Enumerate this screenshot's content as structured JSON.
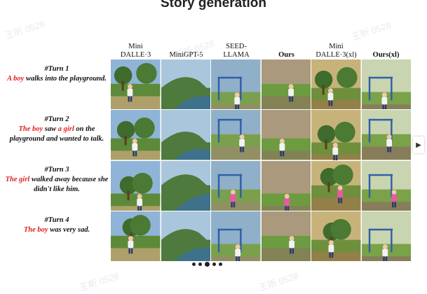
{
  "title": "Story generation",
  "watermark": "王昕 0528",
  "columns": [
    "Mini DALLE·3",
    "MiniGPT-5",
    "SEED-LLAMA",
    "Ours",
    "Mini DALLE·3(xl)",
    "Ours(xl)"
  ],
  "turns": [
    {
      "label": "#Turn 1",
      "parts": [
        {
          "t": "A boy",
          "hl": true
        },
        {
          "t": " walks into the playground.",
          "hl": false
        }
      ]
    },
    {
      "label": "#Turn 2",
      "parts": [
        {
          "t": "The boy",
          "hl": true
        },
        {
          "t": " saw ",
          "hl": false
        },
        {
          "t": "a girl",
          "hl": true
        },
        {
          "t": " on the playground and wanted to talk.",
          "hl": false
        }
      ]
    },
    {
      "label": "#Turn 3",
      "parts": [
        {
          "t": "The girl",
          "hl": true
        },
        {
          "t": " walked away because she didn't like him.",
          "hl": false
        }
      ]
    },
    {
      "label": "#Turn 4",
      "parts": [
        {
          "t": "The boy",
          "hl": true
        },
        {
          "t": " was very sad.",
          "hl": false
        }
      ]
    }
  ],
  "colors": {
    "highlight": "#e0201f"
  },
  "nav": {
    "next_icon": "▶"
  },
  "pagination": {
    "count": 5,
    "active": 2
  }
}
